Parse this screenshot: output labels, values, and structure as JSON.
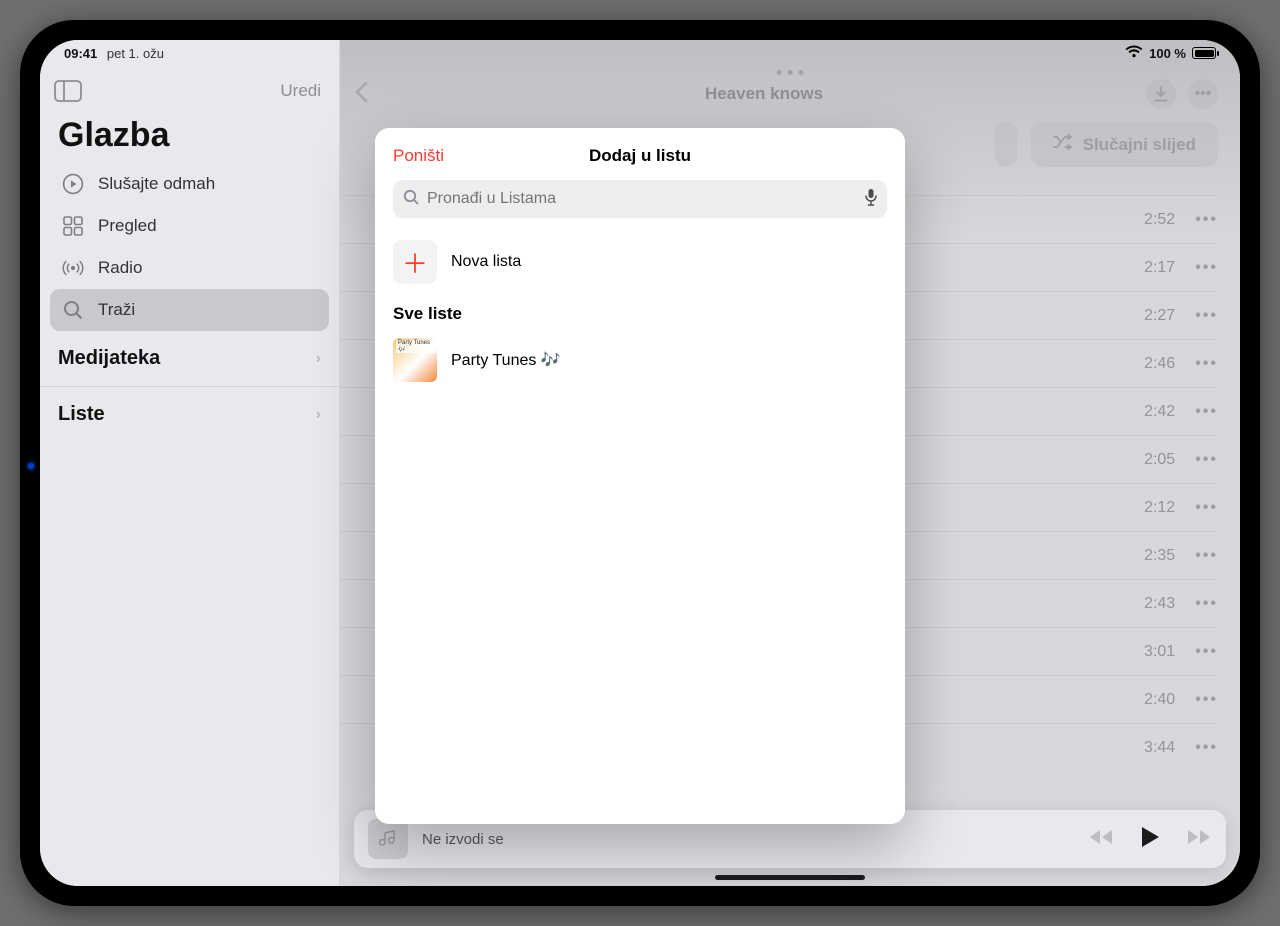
{
  "status": {
    "time": "09:41",
    "date": "pet 1. ožu",
    "battery_pct": "100 %"
  },
  "sidebar": {
    "edit": "Uredi",
    "app_title": "Glazba",
    "items": [
      {
        "label": "Slušajte odmah"
      },
      {
        "label": "Pregled"
      },
      {
        "label": "Radio"
      },
      {
        "label": "Traži"
      }
    ],
    "sections": [
      {
        "label": "Medijateka"
      },
      {
        "label": "Liste"
      }
    ]
  },
  "header": {
    "title": "Heaven knows"
  },
  "actions": {
    "shuffle": "Slučajni slijed"
  },
  "tracks": [
    {
      "duration": "2:52"
    },
    {
      "duration": "2:17"
    },
    {
      "duration": "2:27"
    },
    {
      "duration": "2:46"
    },
    {
      "duration": "2:42"
    },
    {
      "duration": "2:05"
    },
    {
      "duration": "2:12"
    },
    {
      "duration": "2:35"
    },
    {
      "duration": "2:43"
    },
    {
      "duration": "3:01"
    },
    {
      "duration": "2:40"
    },
    {
      "duration": "3:44"
    }
  ],
  "nowplaying": {
    "status": "Ne izvodi se"
  },
  "modal": {
    "cancel": "Poništi",
    "title": "Dodaj u listu",
    "search_placeholder": "Pronađi u Listama",
    "new_list": "Nova lista",
    "section": "Sve liste",
    "playlists": [
      {
        "name": "Party Tunes 🎶",
        "thumb_label": "Party Tunes 🎶"
      }
    ]
  }
}
